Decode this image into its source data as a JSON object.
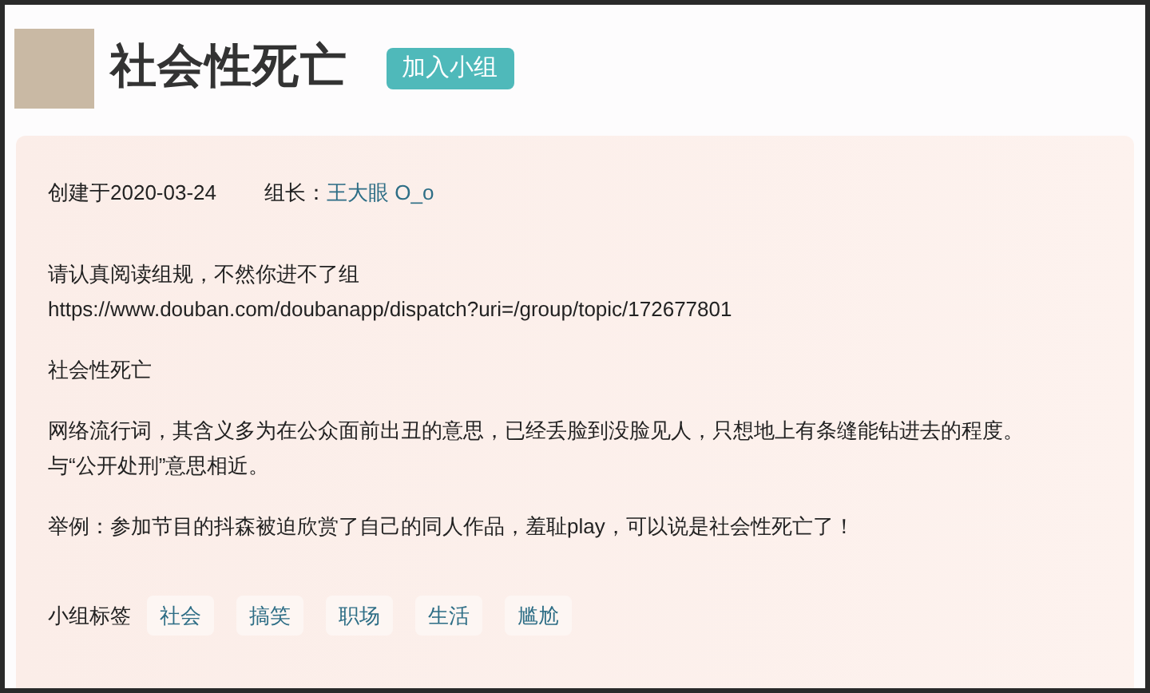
{
  "group": {
    "title": "社会性死亡",
    "join_button": "加入小组"
  },
  "meta": {
    "created": "创建于2020-03-24",
    "owner_label": "组长：",
    "owner": "王大眼 O_o"
  },
  "paragraphs": [
    [
      "请认真阅读组规，不然你进不了组",
      "https://www.douban.com/doubanapp/dispatch?uri=/group/topic/172677801"
    ],
    [
      "社会性死亡"
    ],
    [
      "网络流行词，其含义多为在公众面前出丑的意思，已经丢脸到没脸见人，只想地上有条缝能钻进去的程度。",
      "与“公开处刑”意思相近。"
    ],
    [
      "举例：参加节目的抖森被迫欣赏了自己的同人作品，羞耻play，可以说是社会性死亡了！"
    ]
  ],
  "tags": {
    "label": "小组标签",
    "items": [
      "社会",
      "搞笑",
      "职场",
      "生活",
      "尴尬"
    ]
  }
}
